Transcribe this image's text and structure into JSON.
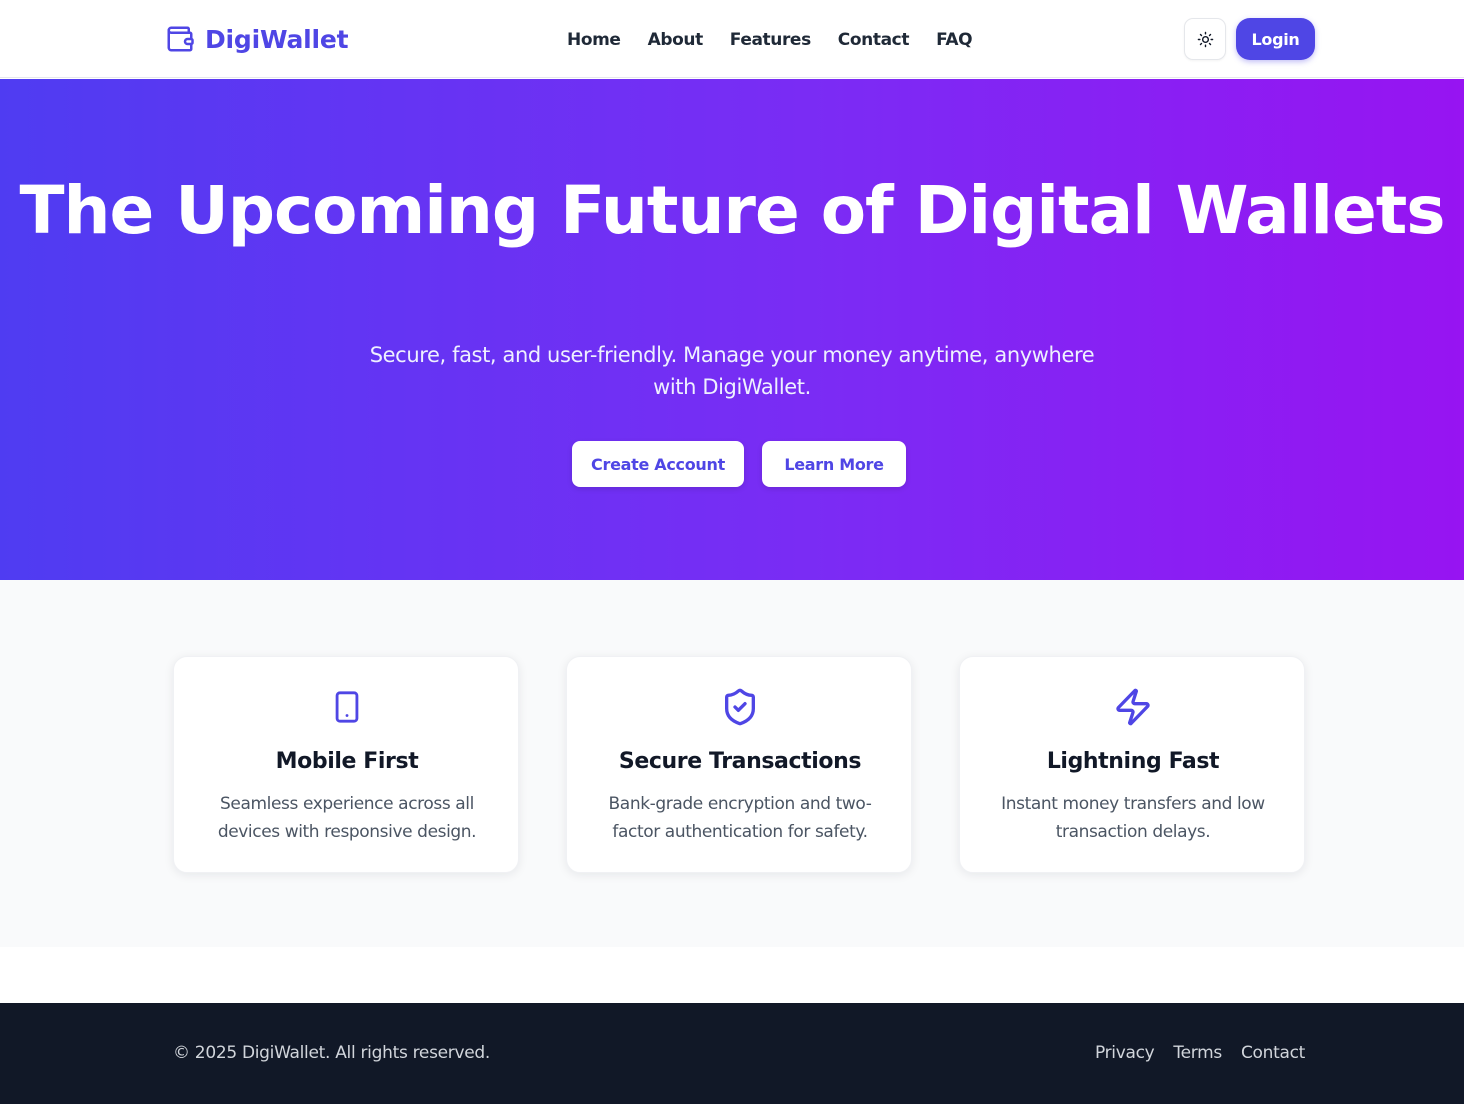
{
  "header": {
    "brand": "DigiWallet",
    "nav": [
      "Home",
      "About",
      "Features",
      "Contact",
      "FAQ"
    ],
    "login_label": "Login"
  },
  "hero": {
    "title": "The Upcoming Future of Digital Wallets",
    "subtitle": "Secure, fast, and user-friendly. Manage your money anytime, anywhere with DigiWallet.",
    "primary_cta": "Create Account",
    "secondary_cta": "Learn More"
  },
  "features": [
    {
      "icon": "smartphone-icon",
      "title": "Mobile First",
      "text": "Seamless experience across all devices with responsive design."
    },
    {
      "icon": "shield-check-icon",
      "title": "Secure Transactions",
      "text": "Bank-grade encryption and two-factor authentication for safety."
    },
    {
      "icon": "lightning-icon",
      "title": "Lightning Fast",
      "text": "Instant money transfers and low transaction delays."
    }
  ],
  "footer": {
    "copyright": "© 2025 DigiWallet. All rights reserved.",
    "links": [
      "Privacy",
      "Terms",
      "Contact"
    ]
  },
  "colors": {
    "accent": "#4f46e5",
    "hero_gradient_start": "#4f3cf2",
    "hero_gradient_end": "#9714f2",
    "footer_bg": "#111827"
  }
}
